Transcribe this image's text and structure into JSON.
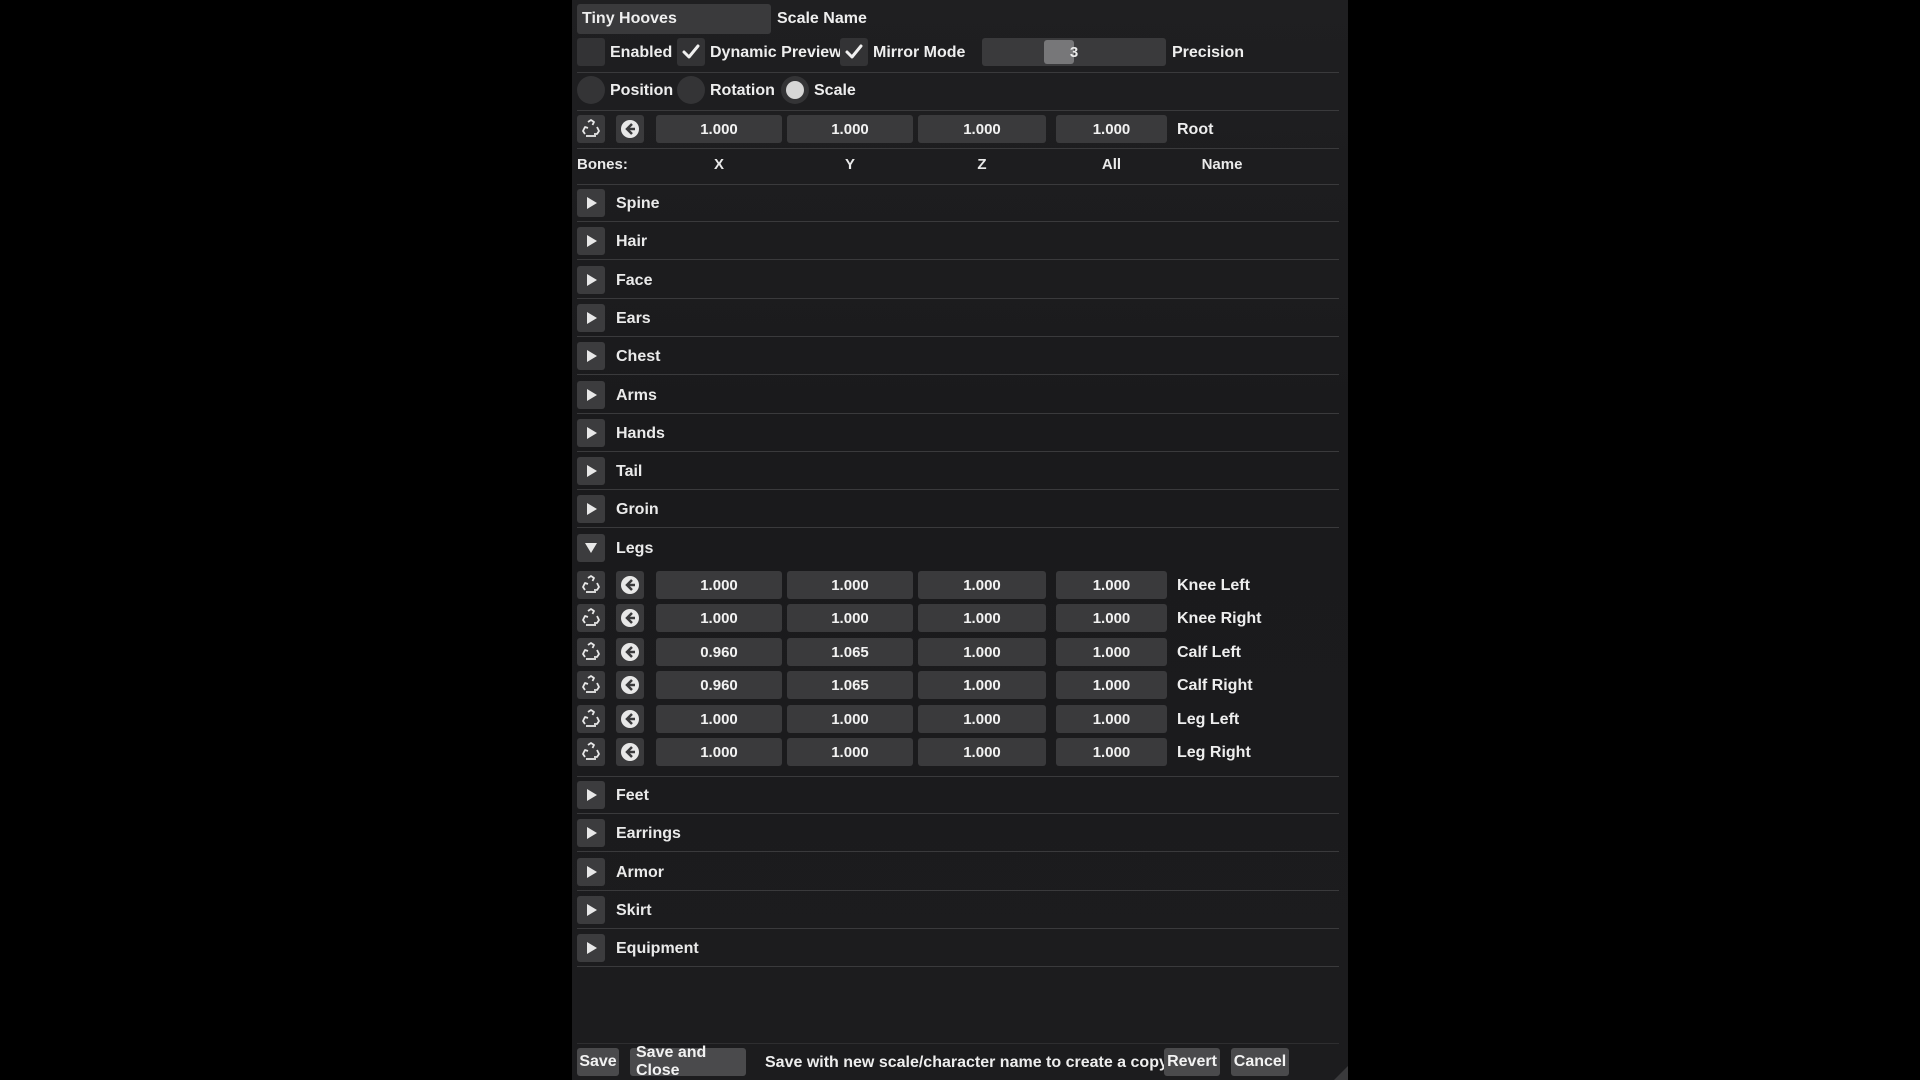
{
  "header": {
    "scale_name_value": "Tiny Hooves",
    "scale_name_label": "Scale Name"
  },
  "options": {
    "enabled": {
      "label": "Enabled",
      "checked": false
    },
    "dynamic_preview": {
      "label": "Dynamic Preview",
      "checked": true
    },
    "mirror_mode": {
      "label": "Mirror Mode",
      "checked": true
    },
    "precision": {
      "label": "Precision",
      "value": "3"
    }
  },
  "mode": {
    "position_label": "Position",
    "rotation_label": "Rotation",
    "scale_label": "Scale",
    "selected": "Scale"
  },
  "root": {
    "x": "1.000",
    "y": "1.000",
    "z": "1.000",
    "all": "1.000",
    "name": "Root"
  },
  "columns": {
    "bones": "Bones:",
    "x": "X",
    "y": "Y",
    "z": "Z",
    "all": "All",
    "name": "Name"
  },
  "categories_before": [
    "Spine",
    "Hair",
    "Face",
    "Ears",
    "Chest",
    "Arms",
    "Hands",
    "Tail",
    "Groin"
  ],
  "expanded_category": "Legs",
  "leg_bones": [
    {
      "x": "1.000",
      "y": "1.000",
      "z": "1.000",
      "all": "1.000",
      "name": "Knee Left"
    },
    {
      "x": "1.000",
      "y": "1.000",
      "z": "1.000",
      "all": "1.000",
      "name": "Knee Right"
    },
    {
      "x": "0.960",
      "y": "1.065",
      "z": "1.000",
      "all": "1.000",
      "name": "Calf Left"
    },
    {
      "x": "0.960",
      "y": "1.065",
      "z": "1.000",
      "all": "1.000",
      "name": "Calf Right"
    },
    {
      "x": "1.000",
      "y": "1.000",
      "z": "1.000",
      "all": "1.000",
      "name": "Leg Left"
    },
    {
      "x": "1.000",
      "y": "1.000",
      "z": "1.000",
      "all": "1.000",
      "name": "Leg Right"
    }
  ],
  "categories_after": [
    "Feet",
    "Earrings",
    "Armor",
    "Skirt",
    "Equipment"
  ],
  "footer": {
    "save": "Save",
    "save_and_close": "Save and Close",
    "hint": "Save with new scale/character name to create a copy.",
    "revert": "Revert",
    "cancel": "Cancel"
  },
  "icons": {
    "reset": "recycle-icon",
    "revert": "back-arrow-icon",
    "collapsed": "triangle-right-icon",
    "expanded": "triangle-down-icon",
    "check": "checkmark-icon"
  }
}
